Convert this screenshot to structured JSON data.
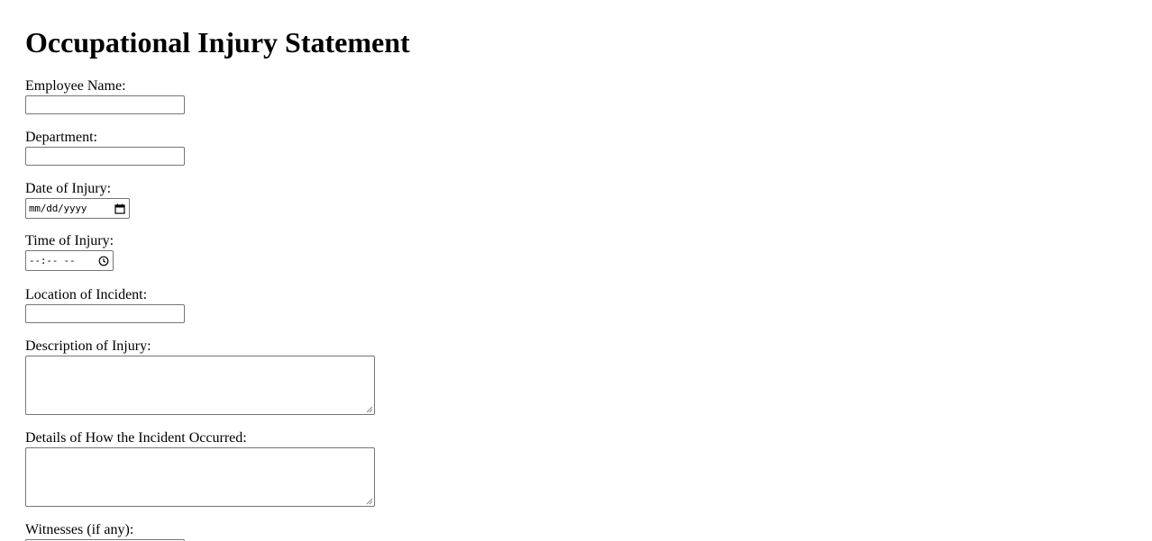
{
  "form": {
    "title": "Occupational Injury Statement",
    "fields": {
      "employee_name": {
        "label": "Employee Name:",
        "value": ""
      },
      "department": {
        "label": "Department:",
        "value": ""
      },
      "date_of_injury": {
        "label": "Date of Injury:",
        "placeholder": "mm/dd/yyyy"
      },
      "time_of_injury": {
        "label": "Time of Injury:",
        "placeholder": "--:-- --"
      },
      "location": {
        "label": "Location of Incident:",
        "value": ""
      },
      "description": {
        "label": "Description of Injury:",
        "value": ""
      },
      "details": {
        "label": "Details of How the Incident Occurred:",
        "value": ""
      },
      "witnesses": {
        "label": "Witnesses (if any):",
        "value": ""
      }
    },
    "icons": {
      "date": "calendar-icon",
      "time": "clock-icon",
      "resize": "resize-grip-icon"
    }
  }
}
